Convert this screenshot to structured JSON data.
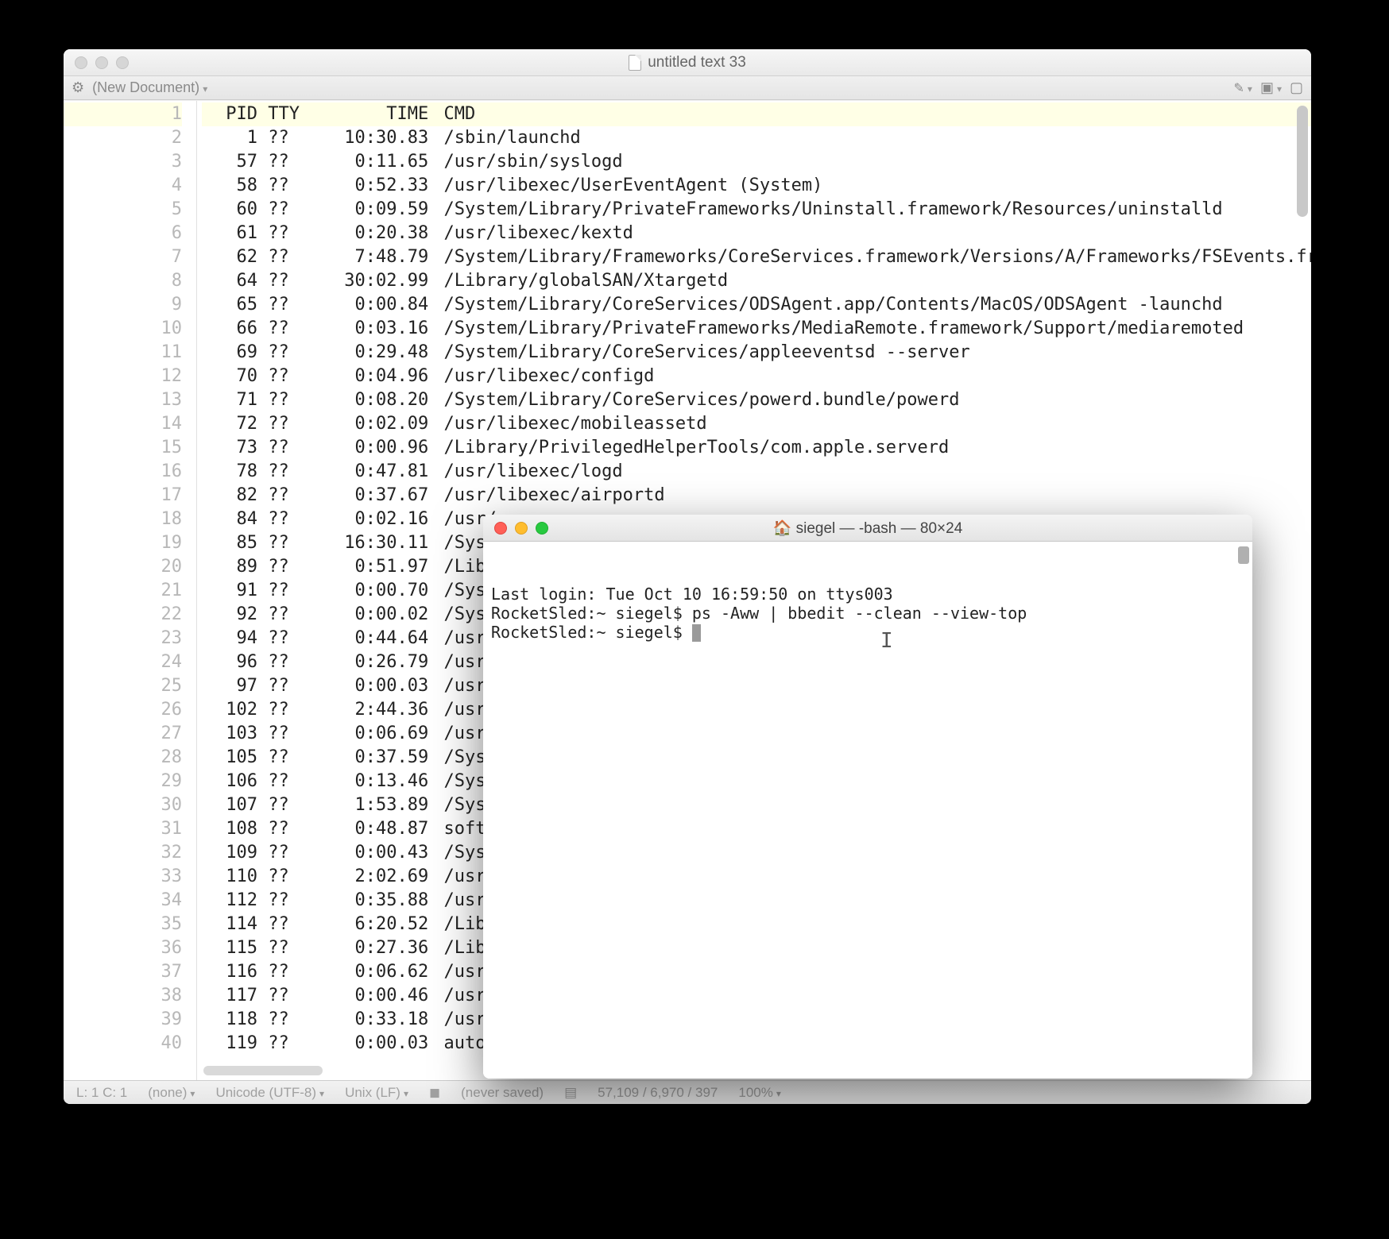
{
  "bbedit": {
    "title": "untitled text 33",
    "newDocument": "(New Document)",
    "header": {
      "pid": "PID",
      "tty": "TTY",
      "time": "TIME",
      "cmd": "CMD"
    },
    "processes": [
      {
        "pid": "1",
        "tty": "??",
        "time": "10:30.83",
        "cmd": "/sbin/launchd"
      },
      {
        "pid": "57",
        "tty": "??",
        "time": "0:11.65",
        "cmd": "/usr/sbin/syslogd"
      },
      {
        "pid": "58",
        "tty": "??",
        "time": "0:52.33",
        "cmd": "/usr/libexec/UserEventAgent (System)"
      },
      {
        "pid": "60",
        "tty": "??",
        "time": "0:09.59",
        "cmd": "/System/Library/PrivateFrameworks/Uninstall.framework/Resources/uninstalld"
      },
      {
        "pid": "61",
        "tty": "??",
        "time": "0:20.38",
        "cmd": "/usr/libexec/kextd"
      },
      {
        "pid": "62",
        "tty": "??",
        "time": "7:48.79",
        "cmd": "/System/Library/Frameworks/CoreServices.framework/Versions/A/Frameworks/FSEvents.fr"
      },
      {
        "pid": "64",
        "tty": "??",
        "time": "30:02.99",
        "cmd": "/Library/globalSAN/Xtargetd"
      },
      {
        "pid": "65",
        "tty": "??",
        "time": "0:00.84",
        "cmd": "/System/Library/CoreServices/ODSAgent.app/Contents/MacOS/ODSAgent -launchd"
      },
      {
        "pid": "66",
        "tty": "??",
        "time": "0:03.16",
        "cmd": "/System/Library/PrivateFrameworks/MediaRemote.framework/Support/mediaremoted"
      },
      {
        "pid": "69",
        "tty": "??",
        "time": "0:29.48",
        "cmd": "/System/Library/CoreServices/appleeventsd --server"
      },
      {
        "pid": "70",
        "tty": "??",
        "time": "0:04.96",
        "cmd": "/usr/libexec/configd"
      },
      {
        "pid": "71",
        "tty": "??",
        "time": "0:08.20",
        "cmd": "/System/Library/CoreServices/powerd.bundle/powerd"
      },
      {
        "pid": "72",
        "tty": "??",
        "time": "0:02.09",
        "cmd": "/usr/libexec/mobileassetd"
      },
      {
        "pid": "73",
        "tty": "??",
        "time": "0:00.96",
        "cmd": "/Library/PrivilegedHelperTools/com.apple.serverd"
      },
      {
        "pid": "78",
        "tty": "??",
        "time": "0:47.81",
        "cmd": "/usr/libexec/logd"
      },
      {
        "pid": "82",
        "tty": "??",
        "time": "0:37.67",
        "cmd": "/usr/libexec/airportd"
      },
      {
        "pid": "84",
        "tty": "??",
        "time": "0:02.16",
        "cmd": "/usr/"
      },
      {
        "pid": "85",
        "tty": "??",
        "time": "16:30.11",
        "cmd": "/Syst"
      },
      {
        "pid": "89",
        "tty": "??",
        "time": "0:51.97",
        "cmd": "/Libr"
      },
      {
        "pid": "91",
        "tty": "??",
        "time": "0:00.70",
        "cmd": "/Syst"
      },
      {
        "pid": "92",
        "tty": "??",
        "time": "0:00.02",
        "cmd": "/Syst"
      },
      {
        "pid": "94",
        "tty": "??",
        "time": "0:44.64",
        "cmd": "/usr/"
      },
      {
        "pid": "96",
        "tty": "??",
        "time": "0:26.79",
        "cmd": "/usr/"
      },
      {
        "pid": "97",
        "tty": "??",
        "time": "0:00.03",
        "cmd": "/usr/"
      },
      {
        "pid": "102",
        "tty": "??",
        "time": "2:44.36",
        "cmd": "/usr/"
      },
      {
        "pid": "103",
        "tty": "??",
        "time": "0:06.69",
        "cmd": "/usr/"
      },
      {
        "pid": "105",
        "tty": "??",
        "time": "0:37.59",
        "cmd": "/Syst"
      },
      {
        "pid": "106",
        "tty": "??",
        "time": "0:13.46",
        "cmd": "/Syst"
      },
      {
        "pid": "107",
        "tty": "??",
        "time": "1:53.89",
        "cmd": "/Syst"
      },
      {
        "pid": "108",
        "tty": "??",
        "time": "0:48.87",
        "cmd": "softr"
      },
      {
        "pid": "109",
        "tty": "??",
        "time": "0:00.43",
        "cmd": "/Syst"
      },
      {
        "pid": "110",
        "tty": "??",
        "time": "2:02.69",
        "cmd": "/usr/"
      },
      {
        "pid": "112",
        "tty": "??",
        "time": "0:35.88",
        "cmd": "/usr/"
      },
      {
        "pid": "114",
        "tty": "??",
        "time": "6:20.52",
        "cmd": "/Libr"
      },
      {
        "pid": "115",
        "tty": "??",
        "time": "0:27.36",
        "cmd": "/Libr"
      },
      {
        "pid": "116",
        "tty": "??",
        "time": "0:06.62",
        "cmd": "/usr/"
      },
      {
        "pid": "117",
        "tty": "??",
        "time": "0:00.46",
        "cmd": "/usr/"
      },
      {
        "pid": "118",
        "tty": "??",
        "time": "0:33.18",
        "cmd": "/usr/"
      },
      {
        "pid": "119",
        "tty": "??",
        "time": "0:00.03",
        "cmd": "autof"
      }
    ],
    "status": {
      "cursor": "L: 1 C: 1",
      "language": "(none)",
      "encoding": "Unicode (UTF-8)",
      "lineEndings": "Unix (LF)",
      "saved": "(never saved)",
      "stats": "57,109 / 6,970 / 397",
      "zoom": "100%"
    }
  },
  "terminal": {
    "title": "🏠 siegel — -bash — 80×24",
    "lines": [
      "Last login: Tue Oct 10 16:59:50 on ttys003",
      "RocketSled:~ siegel$ ps -Aww | bbedit --clean --view-top",
      "RocketSled:~ siegel$ "
    ]
  }
}
